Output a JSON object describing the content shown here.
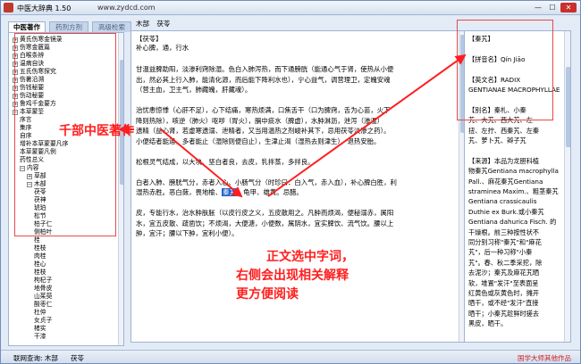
{
  "window": {
    "title": "中医大辞典 1.50",
    "url": "www.zydcd.com",
    "minimize": "—",
    "maximize": "☐",
    "close": "✕"
  },
  "left_tabs": [
    "中医著作",
    "药剂方剂",
    "高级检索"
  ],
  "tree": [
    {
      "label": "黄氏伤寒金镜录",
      "depth": 0,
      "exp": "+"
    },
    {
      "label": "伤寒金匮篇",
      "depth": 0,
      "exp": "+"
    },
    {
      "label": "白喉条辨",
      "depth": 0,
      "exp": "+"
    },
    {
      "label": "温病自诀",
      "depth": 0,
      "exp": "+"
    },
    {
      "label": "五氏伤寒探究",
      "depth": 0,
      "exp": "+"
    },
    {
      "label": "伤暑沿溯",
      "depth": 0,
      "exp": "+"
    },
    {
      "label": "伤钱秘要",
      "depth": 0,
      "exp": "+"
    },
    {
      "label": "伤动秘要",
      "depth": 0,
      "exp": "+"
    },
    {
      "label": "鲁鸡千金要方",
      "depth": 0,
      "exp": "+"
    },
    {
      "label": "本草蒙筌",
      "depth": 0,
      "exp": "−"
    },
    {
      "label": "序言",
      "depth": 1,
      "exp": ""
    },
    {
      "label": "集序",
      "depth": 1,
      "exp": ""
    },
    {
      "label": "自序",
      "depth": 1,
      "exp": ""
    },
    {
      "label": "增补本草蒙要凡序",
      "depth": 1,
      "exp": ""
    },
    {
      "label": "本草蒙要凡例",
      "depth": 1,
      "exp": ""
    },
    {
      "label": "药性总义",
      "depth": 1,
      "exp": ""
    },
    {
      "label": "内容",
      "depth": 1,
      "exp": "−"
    },
    {
      "label": "草部",
      "depth": 2,
      "exp": "+"
    },
    {
      "label": "木部",
      "depth": 2,
      "exp": "−"
    },
    {
      "label": "茯苓",
      "depth": 3,
      "exp": ""
    },
    {
      "label": "茯神",
      "depth": 3,
      "exp": ""
    },
    {
      "label": "琥珀",
      "depth": 3,
      "exp": ""
    },
    {
      "label": "松节",
      "depth": 3,
      "exp": ""
    },
    {
      "label": "柏子仁",
      "depth": 3,
      "exp": ""
    },
    {
      "label": "侧柏叶",
      "depth": 3,
      "exp": ""
    },
    {
      "label": "桂",
      "depth": 3,
      "exp": ""
    },
    {
      "label": "桂枝",
      "depth": 3,
      "exp": ""
    },
    {
      "label": "肉桂",
      "depth": 3,
      "exp": ""
    },
    {
      "label": "桂心",
      "depth": 3,
      "exp": ""
    },
    {
      "label": "桂枝",
      "depth": 3,
      "exp": ""
    },
    {
      "label": "枸杞子",
      "depth": 3,
      "exp": ""
    },
    {
      "label": "地骨皮",
      "depth": 3,
      "exp": ""
    },
    {
      "label": "山茱萸",
      "depth": 3,
      "exp": ""
    },
    {
      "label": "酸枣仁",
      "depth": 3,
      "exp": ""
    },
    {
      "label": "杜仲",
      "depth": 3,
      "exp": ""
    },
    {
      "label": "女贞子",
      "depth": 3,
      "exp": ""
    },
    {
      "label": "楮实",
      "depth": 3,
      "exp": ""
    },
    {
      "label": "干漆",
      "depth": 3,
      "exp": ""
    }
  ],
  "breadcrumb": [
    "木部",
    "茯苓"
  ],
  "content": {
    "title": "【茯苓】",
    "sub": "补心脾，通，行水",
    "lines": [
      {
        "pre": "甘温益脾助阳，淡渗利窍除湿。色白入肺泻热，而下通膀胱（能通心气于肾，使热从小便",
        "hl": "",
        "post": ""
      },
      {
        "pre": "出，然必其上行入肺，能清化源，而后能下降利水也），宁心益气，调营理卫，定魄安魂",
        "hl": "",
        "post": ""
      },
      {
        "pre": "（营主血，卫主气，肺藏魄，肝藏魂）。",
        "hl": "",
        "post": ""
      },
      {
        "pre": "",
        "hl": "",
        "post": ""
      },
      {
        "pre": "治忧恚惊悸（心肝不足），心下结痛，寒热烦满，口焦舌干（口为脾窍，舌为心苗，火下",
        "hl": "",
        "post": ""
      },
      {
        "pre": "降则热除），咳逆（肺火）呕哕（胃火），膈中痰水（脾虚），水肿淋沥，泄泻（渗湿）",
        "hl": "",
        "post": ""
      },
      {
        "pre": "遗精（益心肾，若虚寒遗溺、泄精者，又当用温热之剂峻补其下，忌用茯苓淡渗之药）。",
        "hl": "",
        "post": ""
      },
      {
        "pre": "小便结者能通，多者能止（湿除则便自止），生津止渴（湿热去则津生），退热安胎。",
        "hl": "",
        "post": ""
      },
      {
        "pre": "",
        "hl": "",
        "post": ""
      },
      {
        "pre": "松根灵气结成，以大块、坚白者良，去皮，乳拌蒸，多拌良。",
        "hl": "",
        "post": ""
      },
      {
        "pre": "",
        "hl": "",
        "post": ""
      },
      {
        "pre": "白者入肺、膀胱气分，赤者入心、小肠气分（时珍曰：白入气，赤入血），补心脾白胜，利",
        "hl": "",
        "post": ""
      },
      {
        "pre": "湿热赤胜。恶白蔹，畏地榆、",
        "hl": "秦艽",
        "post": "、龟甲、雄黄。忌醋。"
      },
      {
        "pre": "",
        "hl": "",
        "post": ""
      },
      {
        "pre": "皮，专能行水，治水肿肤胀（以皮行皮之义，五皮散用之。凡肿而烦渴，便秘溺赤，属阳",
        "hl": "",
        "post": ""
      },
      {
        "pre": "水，宜五皮散、疏凿饮；不烦渴，大便溏，小便数，属阴水，宜实脾饮、流气饮。腰以上",
        "hl": "",
        "post": ""
      },
      {
        "pre": "肿，宜汗；腰以下肿，宜利小便）。",
        "hl": "",
        "post": ""
      }
    ]
  },
  "side": {
    "lines": [
      "【秦艽】",
      "",
      "【拼音名】Qín Jiāo",
      "",
      "【英文名】RADIX",
      "GENTIANAE MACROPHYLLAE",
      "",
      "【别名】秦札、小秦",
      "艽、大艽、西大艽、左",
      "扭、左拧、西秦艽、左秦",
      "艽、萝卜艽、辫子艽",
      "",
      "【来源】本品为龙胆科植",
      "物秦艽Gentiana macrophylla",
      "Pall.、麻花秦艽Gentiana",
      "straminea Maxim.、粗茎秦艽",
      "Gentiana crassicaulis",
      "Duthie ex Burk.或小秦艽",
      "Gentiana dahurica Fisch. 的",
      "干燥根。前三种按性状不",
      "同分别习称\"秦艽\"和\"麻花",
      "艽\"，后一种习称\"小秦",
      "艽\"。春、秋二季采挖，除",
      "去泥沙；秦艽及麻花艽晒",
      "软，堆置\"发汗\"至表面呈",
      "红黄色或灰黄色时，摊开",
      "晒干，或不经\"发汗\"直接",
      "晒干；小秦艽趁鲜时搓去",
      "黑皮，晒干。"
    ]
  },
  "status": {
    "label": "联网查询: 木部",
    "word": "茯苓",
    "right": "国学大师其他作品"
  },
  "annotations": {
    "a1": "千部中医著作",
    "a2_line1": "正文选中字词，",
    "a2_line2": "右侧会出现相关解释",
    "a2_line3": "更方便阅读",
    "color": "#ff1e1e"
  }
}
